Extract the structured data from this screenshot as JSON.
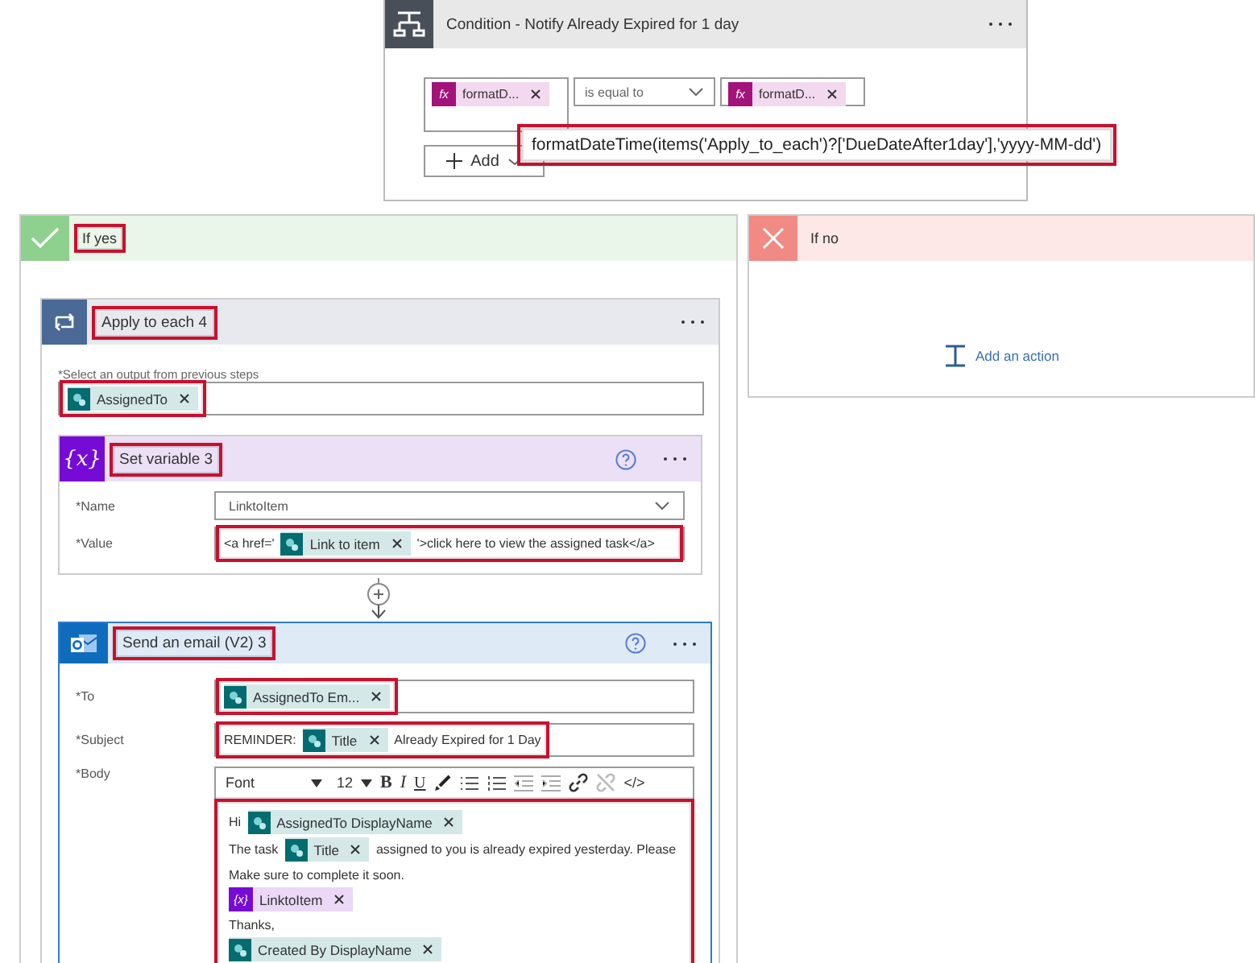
{
  "condition": {
    "title": "Condition - Notify Already Expired for 1 day",
    "left": {
      "kind": "expression_token",
      "icon_text": "fx",
      "label": "formatD..."
    },
    "operator": "is equal to",
    "right": {
      "kind": "expression_token",
      "icon_text": "fx",
      "label": "formatD..."
    },
    "tooltip": {
      "text": "formatDateTime(items('Apply_to_each')?['DueDateAfter1day'],'yyyy-MM-dd')",
      "highlighted": true
    },
    "add_button": "Add"
  },
  "yes_branch": {
    "title": "If yes",
    "highlighted": true,
    "apply_to_each": {
      "title": "Apply to each 4",
      "highlighted": true,
      "select_label": "*Select an output from previous steps",
      "select_value": {
        "highlighted": true,
        "segments": [
          {
            "kind": "sharepoint_token",
            "label": "AssignedTo"
          }
        ]
      },
      "set_variable": {
        "title": "Set variable 3",
        "icon_text": "{x}",
        "highlighted": true,
        "fields": [
          {
            "label": "*Name",
            "kind": "dropdown",
            "value": "LinktoItem"
          },
          {
            "label": "*Value",
            "kind": "text",
            "highlighted": true,
            "segments": [
              {
                "kind": "text",
                "text": "<a href='"
              },
              {
                "kind": "sharepoint_token",
                "label": "Link to item"
              },
              {
                "kind": "text",
                "text": "'>click here to view the assigned task</a>"
              }
            ]
          }
        ]
      },
      "send_email": {
        "title": "Send an email (V2) 3",
        "highlighted": true,
        "fields": [
          {
            "label": "*To",
            "highlighted": true,
            "segments": [
              {
                "kind": "sharepoint_token",
                "label": "AssignedTo Em..."
              }
            ]
          },
          {
            "label": "*Subject",
            "highlighted": true,
            "segments": [
              {
                "kind": "text",
                "text": "REMINDER:"
              },
              {
                "kind": "sharepoint_token",
                "label": "Title"
              },
              {
                "kind": "text",
                "text": "Already Expired for 1 Day"
              }
            ]
          }
        ],
        "body": {
          "label": "*Body",
          "toolbar": {
            "font": "Font",
            "size": "12",
            "bold": "B",
            "italic": "I",
            "underline": "U",
            "code": "</>"
          },
          "highlighted": true,
          "lines": [
            [
              {
                "kind": "text",
                "text": "Hi"
              },
              {
                "kind": "sharepoint_token",
                "label": "AssignedTo DisplayName"
              }
            ],
            [
              {
                "kind": "text",
                "text": "The task"
              },
              {
                "kind": "sharepoint_token",
                "label": "Title"
              },
              {
                "kind": "text",
                "text": "assigned to you is already expired yesterday. Please"
              }
            ],
            [
              {
                "kind": "text",
                "text": "Make sure to complete it soon."
              }
            ],
            [
              {
                "kind": "variable_token",
                "icon_text": "{x}",
                "label": "LinktoItem"
              }
            ],
            [
              {
                "kind": "text",
                "text": "Thanks,"
              }
            ],
            [
              {
                "kind": "sharepoint_token",
                "label": "Created By DisplayName"
              }
            ]
          ]
        }
      }
    }
  },
  "no_branch": {
    "title": "If no",
    "add_action": "Add an action"
  }
}
